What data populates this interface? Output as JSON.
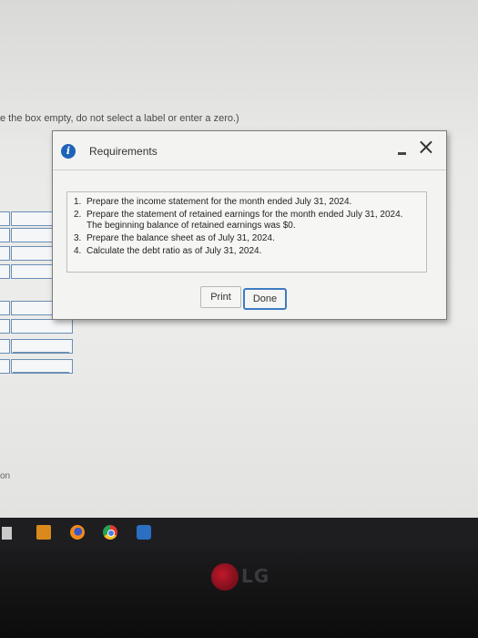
{
  "instruction_text": "e the box empty, do not select a label or enter a zero.)",
  "side_text": "on",
  "dialog": {
    "title": "Requirements",
    "info_icon": "i",
    "minimize_icon": "minimize-icon",
    "close_icon": "×",
    "requirements": [
      {
        "num": "1.",
        "text": "Prepare the income statement for the month ended July 31, 2024."
      },
      {
        "num": "2.",
        "text": "Prepare the statement of retained earnings for the month ended July 31, 2024. The beginning balance of retained earnings was $0."
      },
      {
        "num": "3.",
        "text": "Prepare the balance sheet as of July 31, 2024."
      },
      {
        "num": "4.",
        "text": "Calculate the debt ratio as of July 31, 2024."
      }
    ],
    "print_label": "Print",
    "done_label": "Done"
  },
  "taskbar": {
    "icons": [
      "store-icon",
      "media-player-icon",
      "firefox-icon",
      "chrome-icon",
      "cloud-icon"
    ]
  },
  "monitor_brand": "LG"
}
